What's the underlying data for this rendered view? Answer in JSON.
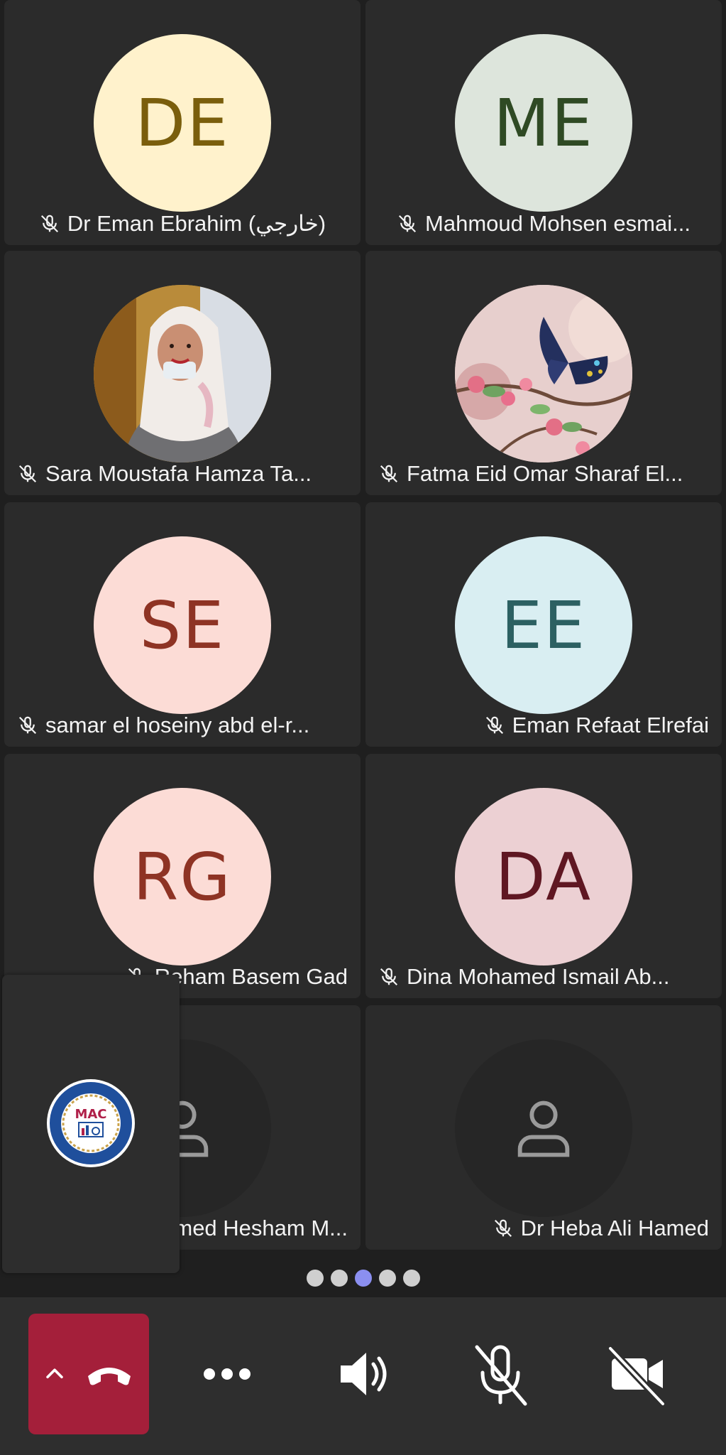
{
  "participants": [
    {
      "initials": "DE",
      "name": "Dr Eman Ebrahim (خارجي)",
      "avatar_bg": "#fff2cc",
      "avatar_fg": "#7a5e0c",
      "align": "center"
    },
    {
      "initials": "ME",
      "name": "Mahmoud Mohsen esmai...",
      "avatar_bg": "#dde5dc",
      "avatar_fg": "#2f4a24",
      "align": "center"
    },
    {
      "initials": "",
      "name": "Sara Moustafa Hamza Ta...",
      "photo": "person-photo",
      "align": "left"
    },
    {
      "initials": "",
      "name": "Fatma Eid Omar Sharaf El...",
      "photo": "butterfly-photo",
      "align": "left"
    },
    {
      "initials": "SE",
      "name": "samar el hoseiny abd el-r...",
      "avatar_bg": "#fcdcd6",
      "avatar_fg": "#8e3324",
      "align": "left"
    },
    {
      "initials": "EE",
      "name": "Eman Refaat Elrefai",
      "avatar_bg": "#d9eef2",
      "avatar_fg": "#2c6062",
      "align": "right"
    },
    {
      "initials": "RG",
      "name": "Reham Basem Gad",
      "avatar_bg": "#fcdcd6",
      "avatar_fg": "#8e3324",
      "align": "right"
    },
    {
      "initials": "DA",
      "name": "Dina Mohamed Ismail Ab...",
      "avatar_bg": "#ecd0d3",
      "avatar_fg": "#5f1722",
      "align": "left"
    },
    {
      "initials": "",
      "name": "Ahmed Hesham M...",
      "placeholder": true,
      "align": "right"
    },
    {
      "initials": "",
      "name": "Dr Heba Ali Hamed",
      "placeholder": true,
      "align": "right"
    }
  ],
  "self_view": {
    "logo_text": "MAC"
  },
  "pagination": {
    "count": 5,
    "active_index": 2
  },
  "controls": {
    "hangup_color": "#a41f3a",
    "icons": [
      "chevron-up-icon",
      "hang-up-icon",
      "more-icon",
      "speaker-icon",
      "mic-off-icon",
      "video-off-icon"
    ]
  }
}
